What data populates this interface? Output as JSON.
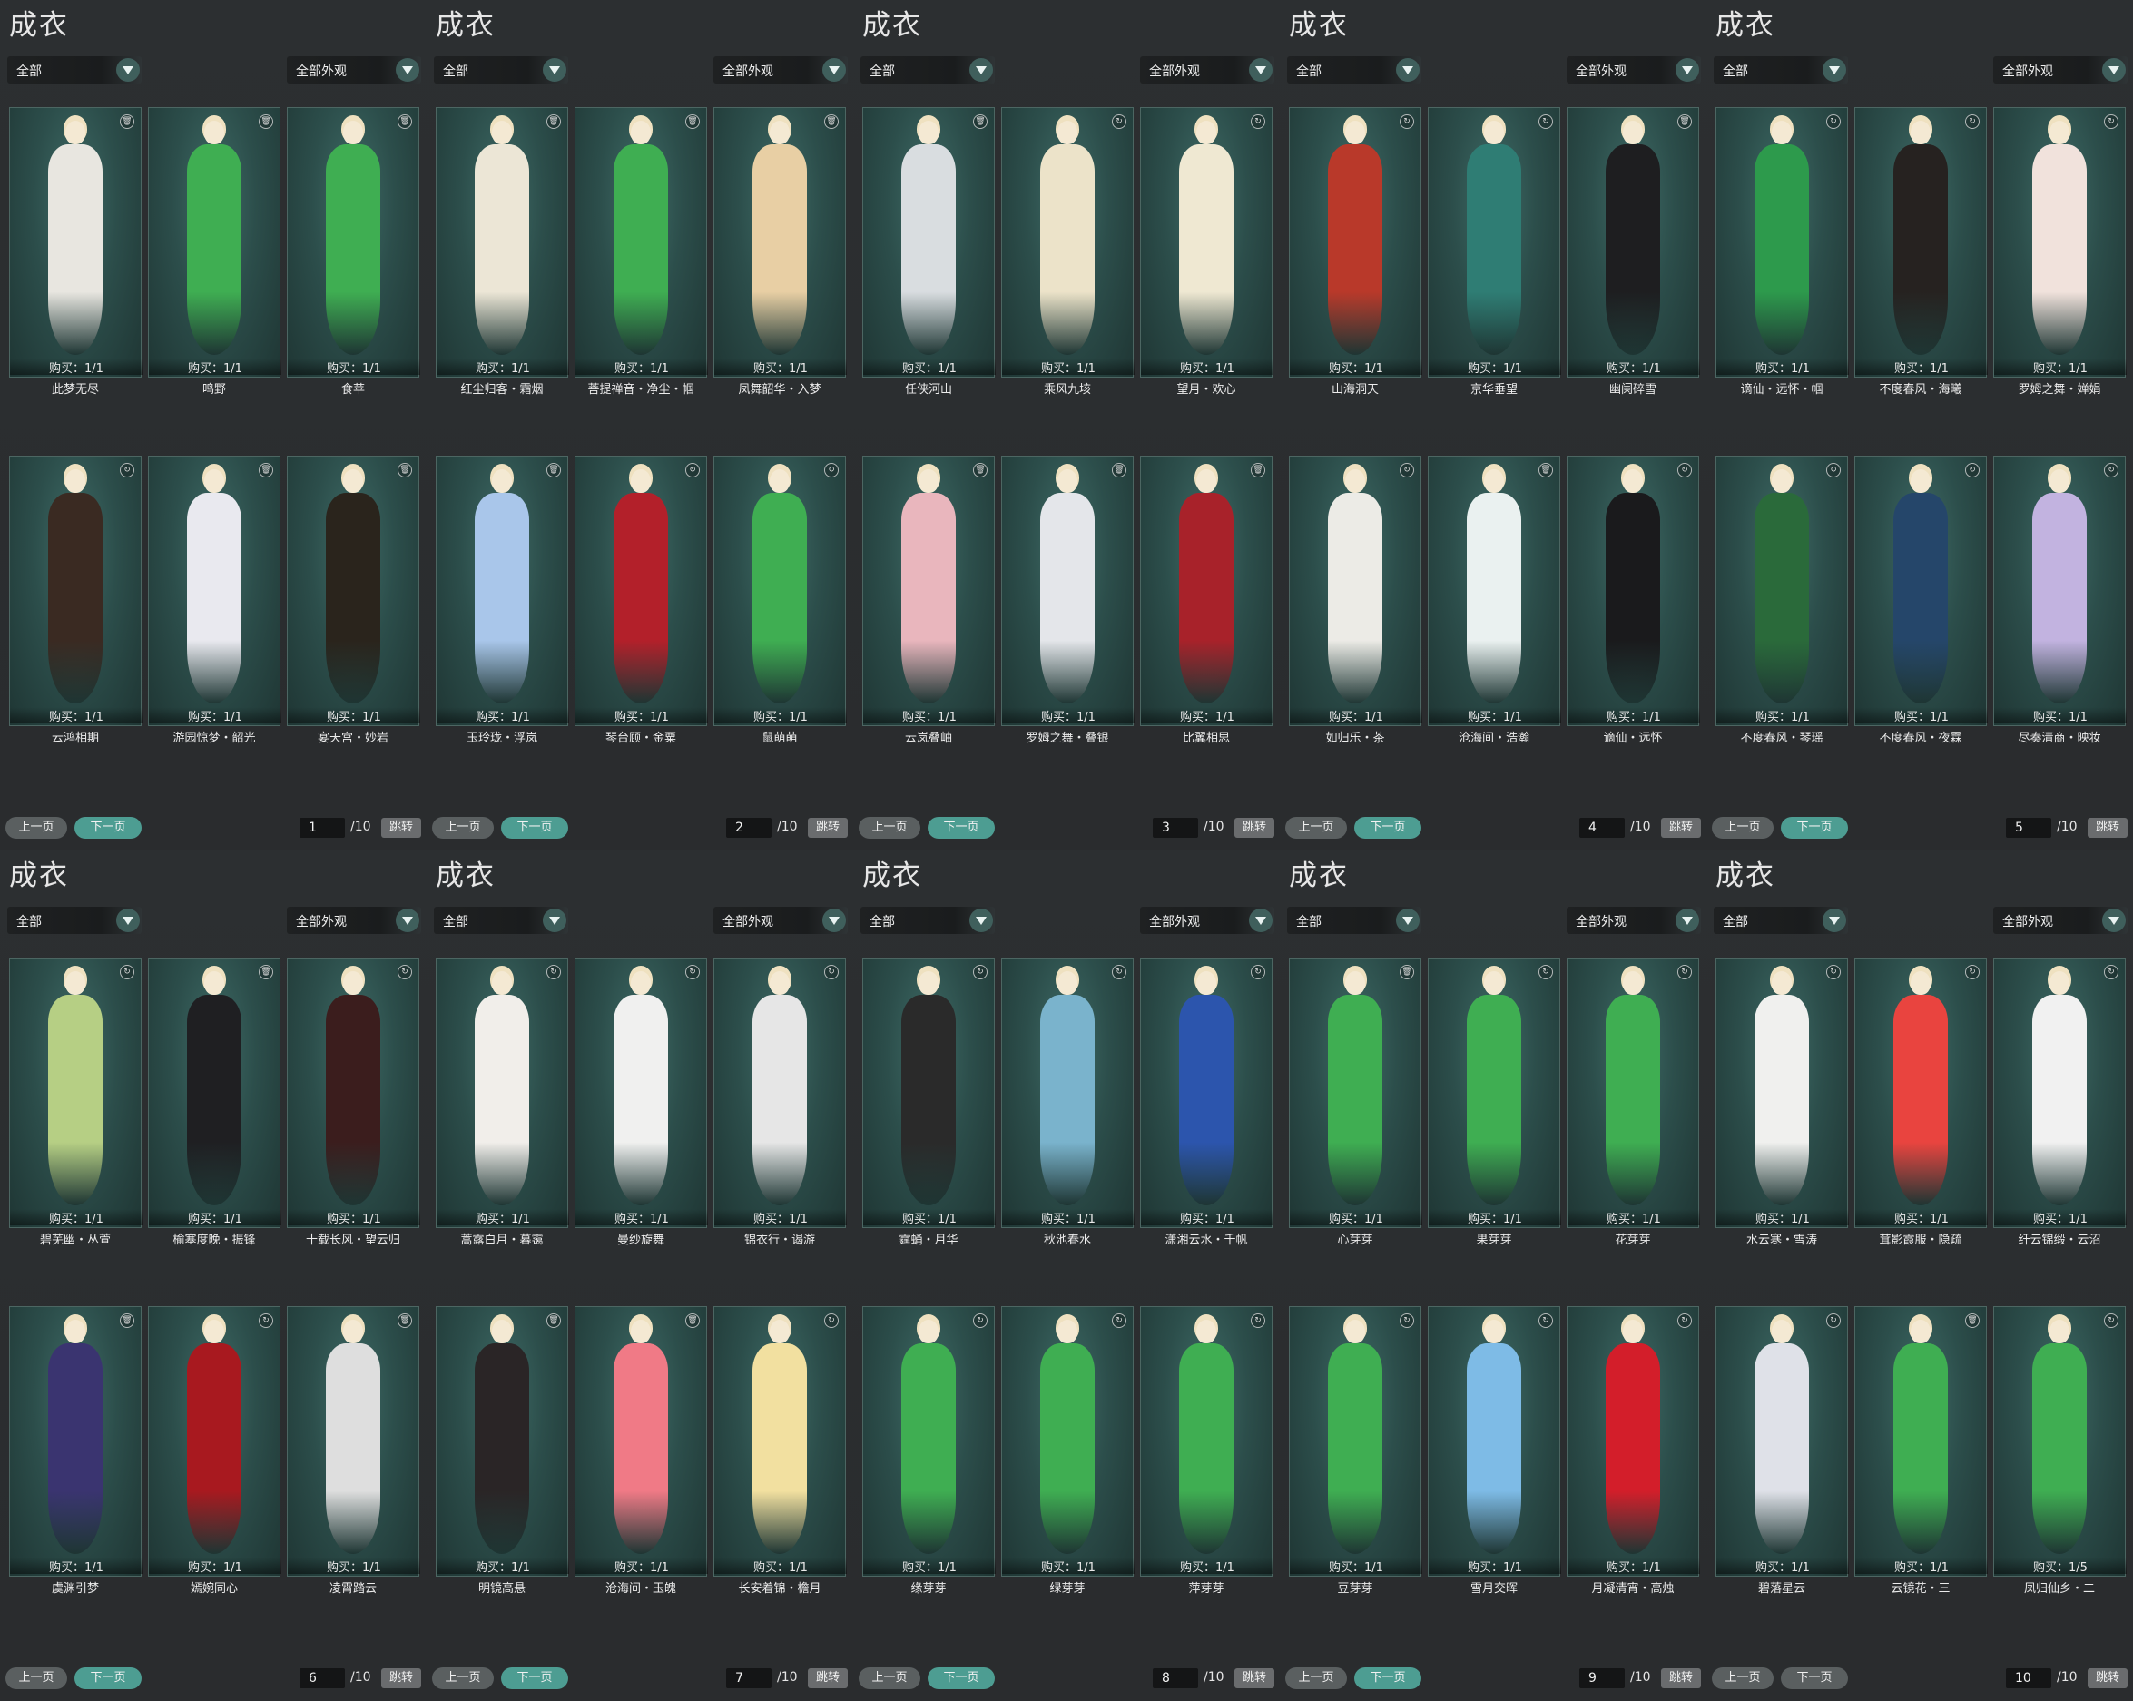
{
  "ui": {
    "panel_title": "成衣",
    "filter_left": "全部",
    "filter_right": "全部外观",
    "prev_label": "上一页",
    "next_label": "下一页",
    "jump_label": "跳转",
    "page_suffix": "/10"
  },
  "colors": {
    "accent": "#4d9d92",
    "card_bg": "#2c4e4b",
    "card_border": "#4c6662",
    "button_grey": "#5a5f60"
  },
  "panels": [
    {
      "page": "1",
      "next_enabled": true,
      "items": [
        {
          "name": "此梦无尽",
          "buy": "购买：1/1",
          "color": "#e8e6e0",
          "icon": "trash-icon"
        },
        {
          "name": "鸣野",
          "buy": "购买：1/1",
          "color": "#3fae52",
          "icon": "trash-icon"
        },
        {
          "name": "食苹",
          "buy": "购买：1/1",
          "color": "#3fae52",
          "icon": "trash-icon"
        },
        {
          "name": "云鸿相期",
          "buy": "购买：1/1",
          "color": "#3a2a22",
          "icon": "refresh-icon"
        },
        {
          "name": "游园惊梦・韶光",
          "buy": "购买：1/1",
          "color": "#e9e9ef",
          "icon": "trash-icon"
        },
        {
          "name": "宴天宫・妙岩",
          "buy": "购买：1/1",
          "color": "#2a241c",
          "icon": "trash-icon"
        }
      ]
    },
    {
      "page": "2",
      "next_enabled": true,
      "items": [
        {
          "name": "红尘归客・霜烟",
          "buy": "购买：1/1",
          "color": "#ece6d6",
          "icon": "trash-icon"
        },
        {
          "name": "菩提禅音・净尘・帼",
          "buy": "购买：1/1",
          "color": "#3fae52",
          "icon": "trash-icon"
        },
        {
          "name": "凤舞韶华・入梦",
          "buy": "购买：1/1",
          "color": "#e8cfa4",
          "icon": "trash-icon"
        },
        {
          "name": "玉玲珑・浮岚",
          "buy": "购买：1/1",
          "color": "#a9c6ea",
          "icon": "trash-icon"
        },
        {
          "name": "琴台顾・金粟",
          "buy": "购买：1/1",
          "color": "#b3202a",
          "icon": "refresh-icon"
        },
        {
          "name": "鼠萌萌",
          "buy": "购买：1/1",
          "color": "#3fae52",
          "icon": "refresh-icon"
        }
      ]
    },
    {
      "page": "3",
      "next_enabled": true,
      "items": [
        {
          "name": "任侠河山",
          "buy": "购买：1/1",
          "color": "#d9dde0",
          "icon": "trash-icon"
        },
        {
          "name": "乘风九垓",
          "buy": "购买：1/1",
          "color": "#ece3c9",
          "icon": "refresh-icon"
        },
        {
          "name": "望月・欢心",
          "buy": "购买：1/1",
          "color": "#efe8d2",
          "icon": "refresh-icon"
        },
        {
          "name": "云岚叠岫",
          "buy": "购买：1/1",
          "color": "#e9b6bd",
          "icon": "trash-icon"
        },
        {
          "name": "罗姆之舞・叠银",
          "buy": "购买：1/1",
          "color": "#e4e6ea",
          "icon": "trash-icon"
        },
        {
          "name": "比翼相思",
          "buy": "购买：1/1",
          "color": "#a8222a",
          "icon": "trash-icon"
        }
      ]
    },
    {
      "page": "4",
      "next_enabled": true,
      "items": [
        {
          "name": "山海洞天",
          "buy": "购买：1/1",
          "color": "#b9392a",
          "icon": "refresh-icon"
        },
        {
          "name": "京华垂望",
          "buy": "购买：1/1",
          "color": "#2f7d74",
          "icon": "refresh-icon"
        },
        {
          "name": "幽阑碎雪",
          "buy": "购买：1/1",
          "color": "#1e1e20",
          "icon": "trash-icon"
        },
        {
          "name": "如归乐・茶",
          "buy": "购买：1/1",
          "color": "#ecebe6",
          "icon": "refresh-icon"
        },
        {
          "name": "沧海间・浩瀚",
          "buy": "购买：1/1",
          "color": "#eaf1f0",
          "icon": "trash-icon"
        },
        {
          "name": "谪仙・远怀",
          "buy": "购买：1/1",
          "color": "#1a1a1c",
          "icon": "refresh-icon"
        }
      ]
    },
    {
      "page": "5",
      "next_enabled": true,
      "items": [
        {
          "name": "谪仙・远怀・帼",
          "buy": "购买：1/1",
          "color": "#2d9a4c",
          "icon": "refresh-icon"
        },
        {
          "name": "不度春风・海曦",
          "buy": "购买：1/1",
          "color": "#262220",
          "icon": "refresh-icon"
        },
        {
          "name": "罗姆之舞・婵娟",
          "buy": "购买：1/1",
          "color": "#f1e2dc",
          "icon": "refresh-icon"
        },
        {
          "name": "不度春风・琴瑶",
          "buy": "购买：1/1",
          "color": "#2a6a3a",
          "icon": "refresh-icon"
        },
        {
          "name": "不度春风・夜霖",
          "buy": "购买：1/1",
          "color": "#25466a",
          "icon": "refresh-icon"
        },
        {
          "name": "尽奏清商・映妆",
          "buy": "购买：1/1",
          "color": "#c2b3e0",
          "icon": "refresh-icon"
        }
      ]
    },
    {
      "page": "6",
      "next_enabled": true,
      "items": [
        {
          "name": "碧芜幽・丛萱",
          "buy": "购买：1/1",
          "color": "#b6cf84",
          "icon": "refresh-icon"
        },
        {
          "name": "榆塞度晚・振锋",
          "buy": "购买：1/1",
          "color": "#1f1f22",
          "icon": "trash-icon"
        },
        {
          "name": "十载长风・望云归",
          "buy": "购买：1/1",
          "color": "#3b1d1d",
          "icon": "refresh-icon"
        },
        {
          "name": "虞渊引梦",
          "buy": "购买：1/1",
          "color": "#3a3470",
          "icon": "trash-icon"
        },
        {
          "name": "嫣婉同心",
          "buy": "购买：1/1",
          "color": "#a8191f",
          "icon": "refresh-icon"
        },
        {
          "name": "凌霄踏云",
          "buy": "购买：1/1",
          "color": "#dedede",
          "icon": "trash-icon"
        }
      ]
    },
    {
      "page": "7",
      "next_enabled": true,
      "items": [
        {
          "name": "蒿露白月・暮霭",
          "buy": "购买：1/1",
          "color": "#f1eeea",
          "icon": "refresh-icon"
        },
        {
          "name": "曼纱旋舞",
          "buy": "购买：1/1",
          "color": "#f0f0ef",
          "icon": "refresh-icon"
        },
        {
          "name": "锦衣行・谒游",
          "buy": "购买：1/1",
          "color": "#e6e6e6",
          "icon": "refresh-icon"
        },
        {
          "name": "明镜高悬",
          "buy": "购买：1/1",
          "color": "#2a2526",
          "icon": "trash-icon"
        },
        {
          "name": "沧海间・玉魄",
          "buy": "购买：1/1",
          "color": "#f07a86",
          "icon": "trash-icon"
        },
        {
          "name": "长安着锦・檐月",
          "buy": "购买：1/1",
          "color": "#f2e0a0",
          "icon": "refresh-icon"
        }
      ]
    },
    {
      "page": "8",
      "next_enabled": true,
      "items": [
        {
          "name": "霆蛹・月华",
          "buy": "购买：1/1",
          "color": "#2a2a2a",
          "icon": "refresh-icon"
        },
        {
          "name": "秋池春水",
          "buy": "购买：1/1",
          "color": "#7ab3cc",
          "icon": "refresh-icon"
        },
        {
          "name": "潇湘云水・千帆",
          "buy": "购买：1/1",
          "color": "#2c55ad",
          "icon": "refresh-icon"
        },
        {
          "name": "缘芽芽",
          "buy": "购买：1/1",
          "color": "#3fae52",
          "icon": "refresh-icon"
        },
        {
          "name": "绿芽芽",
          "buy": "购买：1/1",
          "color": "#3fae52",
          "icon": "refresh-icon"
        },
        {
          "name": "萍芽芽",
          "buy": "购买：1/1",
          "color": "#3fae52",
          "icon": "refresh-icon"
        }
      ]
    },
    {
      "page": "9",
      "next_enabled": true,
      "items": [
        {
          "name": "心芽芽",
          "buy": "购买：1/1",
          "color": "#3fae52",
          "icon": "trash-icon"
        },
        {
          "name": "果芽芽",
          "buy": "购买：1/1",
          "color": "#3fae52",
          "icon": "refresh-icon"
        },
        {
          "name": "花芽芽",
          "buy": "购买：1/1",
          "color": "#3fae52",
          "icon": "refresh-icon"
        },
        {
          "name": "豆芽芽",
          "buy": "购买：1/1",
          "color": "#3fae52",
          "icon": "refresh-icon"
        },
        {
          "name": "雪月交晖",
          "buy": "购买：1/1",
          "color": "#7ebbe6",
          "icon": "refresh-icon"
        },
        {
          "name": "月凝清宵・高烛",
          "buy": "购买：1/1",
          "color": "#d31e2a",
          "icon": "refresh-icon"
        }
      ]
    },
    {
      "page": "10",
      "next_enabled": false,
      "items": [
        {
          "name": "水云寒・雪涛",
          "buy": "购买：1/1",
          "color": "#f0f0ee",
          "icon": "refresh-icon"
        },
        {
          "name": "茸影霞服・隐疏",
          "buy": "购买：1/1",
          "color": "#e9443f",
          "icon": "refresh-icon"
        },
        {
          "name": "纤云锦缎・云沼",
          "buy": "购买：1/1",
          "color": "#f1f1f1",
          "icon": "refresh-icon"
        },
        {
          "name": "碧落星云",
          "buy": "购买：1/1",
          "color": "#dfe1e8",
          "icon": "refresh-icon"
        },
        {
          "name": "云镜花・三",
          "buy": "购买：1/1",
          "color": "#3fae52",
          "icon": "trash-icon"
        },
        {
          "name": "凤归仙乡・二",
          "buy": "购买：1/5",
          "color": "#3fae52",
          "icon": "refresh-icon"
        }
      ]
    }
  ]
}
